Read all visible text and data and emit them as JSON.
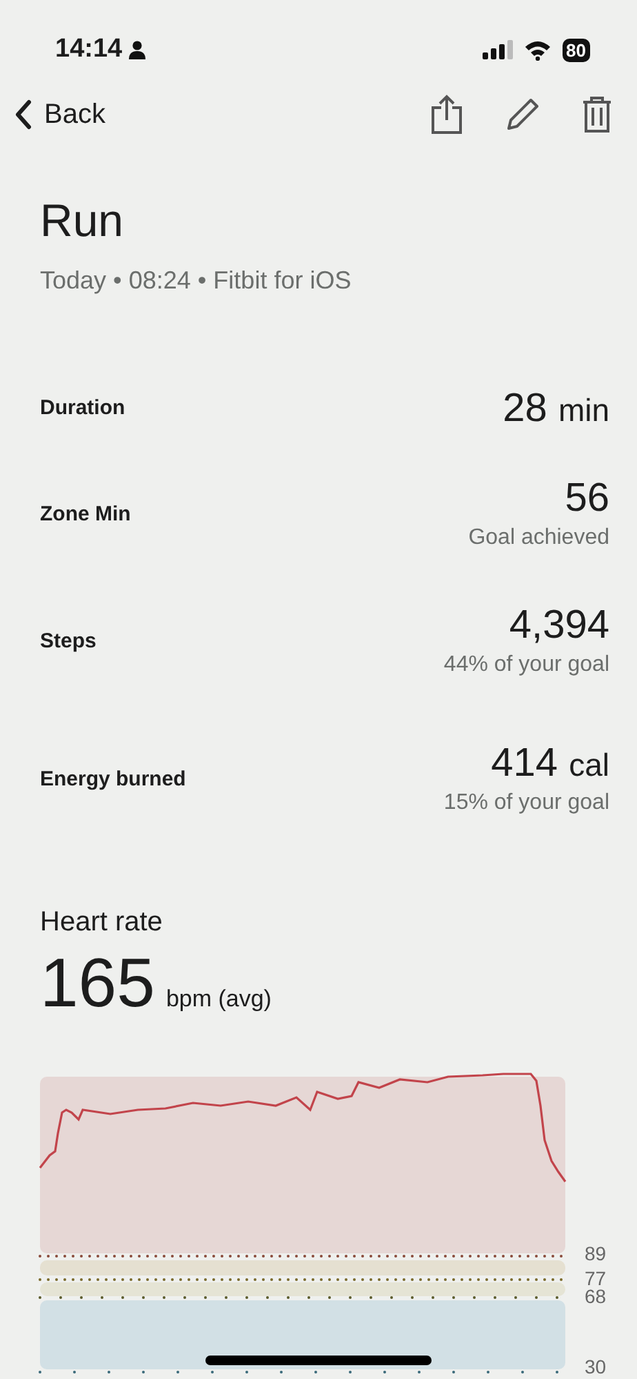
{
  "status_bar": {
    "time": "14:14",
    "battery": "80"
  },
  "nav": {
    "back": "Back"
  },
  "activity": {
    "title": "Run",
    "meta": "Today • 08:24 • Fitbit for iOS"
  },
  "stats": [
    {
      "label": "Duration",
      "value": "28",
      "unit": "min"
    },
    {
      "label": "Zone Min",
      "value": "56",
      "note": "Goal achieved"
    },
    {
      "label": "Steps",
      "value": "4,394",
      "note": "44% of your goal"
    },
    {
      "label": "Energy burned",
      "value": "414",
      "unit": "cal",
      "note": "15% of your goal"
    }
  ],
  "heart_rate": {
    "title": "Heart rate",
    "value": "165",
    "unit": "bpm (avg)",
    "zone_labels": [
      "89",
      "77",
      "68",
      "30"
    ]
  }
}
